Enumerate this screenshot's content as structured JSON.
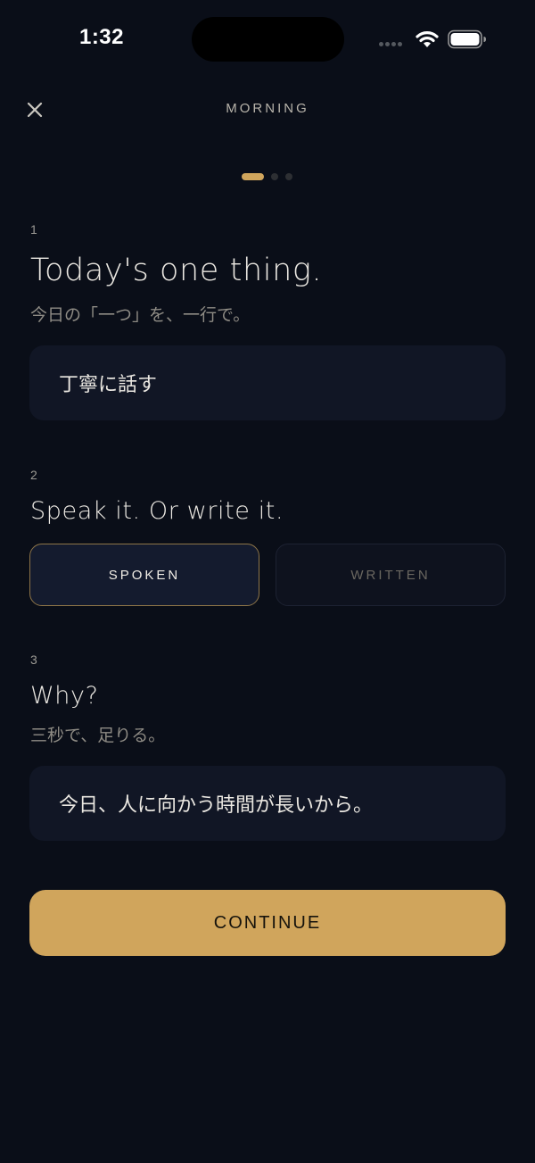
{
  "status_bar": {
    "time": "1:32"
  },
  "header": {
    "title": "MORNING",
    "close_icon": "close-icon"
  },
  "page_indicator": {
    "total": 3,
    "active_index": 0,
    "active_color": "#d0a55c"
  },
  "sections": {
    "one": {
      "number": "1",
      "title": "Today's one thing.",
      "subtitle": "今日の「一つ」を、一行で。",
      "value": "丁寧に話す"
    },
    "two": {
      "number": "2",
      "title": "Speak it. Or write it.",
      "options": [
        "SPOKEN",
        "WRITTEN"
      ],
      "selected": "SPOKEN"
    },
    "three": {
      "number": "3",
      "title": "Why?",
      "subtitle": "三秒で、足りる。",
      "value": "今日、人に向かう時間が長いから。"
    }
  },
  "continue_label": "CONTINUE",
  "colors": {
    "background": "#0a0e18",
    "accent": "#d0a55c",
    "field": "#111625"
  }
}
